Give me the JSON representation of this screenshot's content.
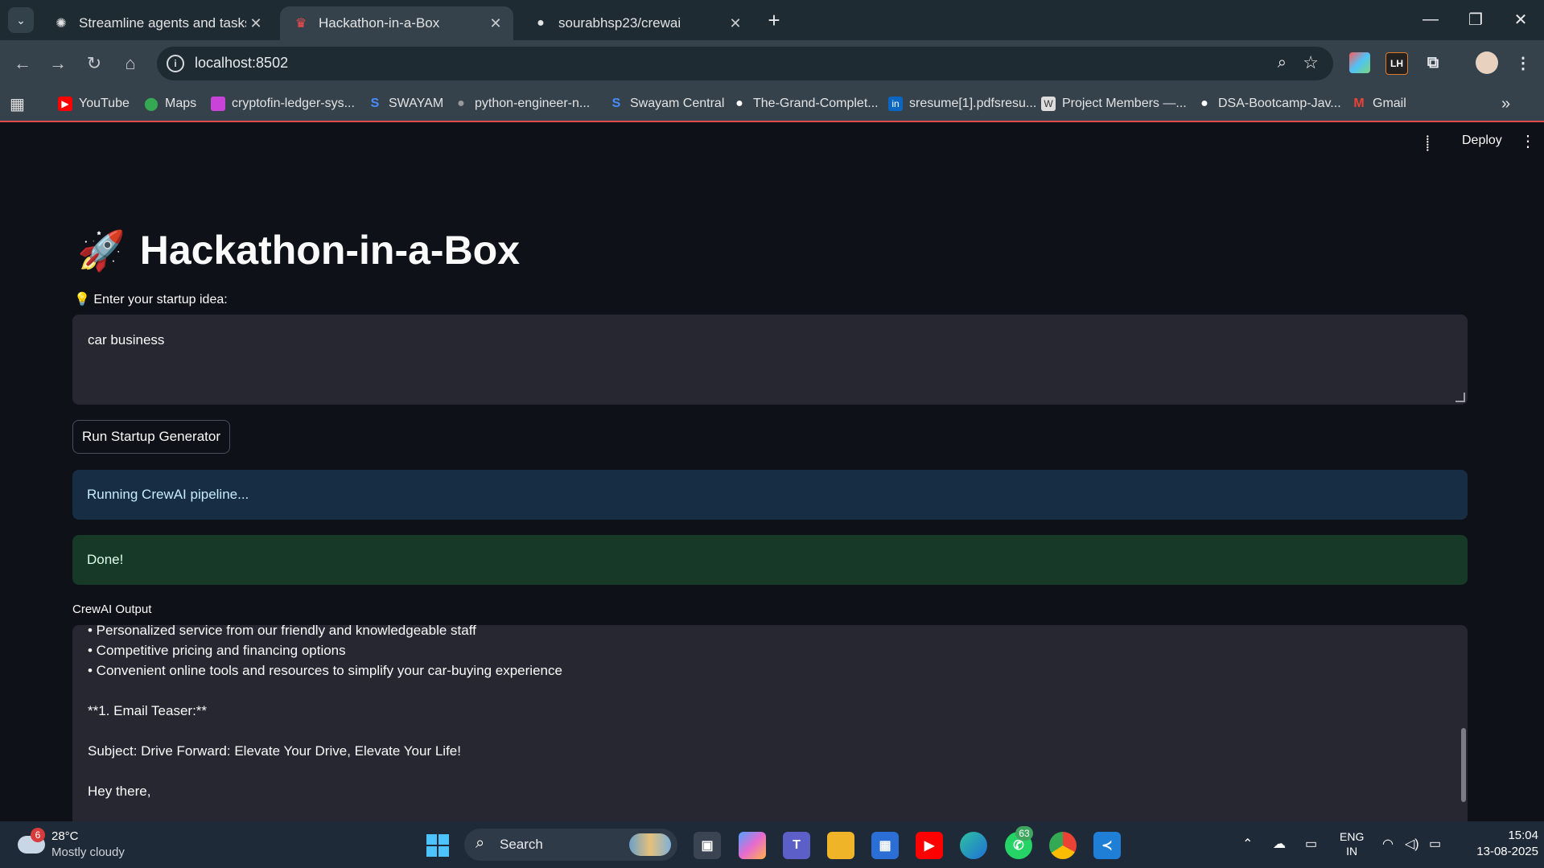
{
  "browser": {
    "tabs": [
      {
        "title": "Streamline agents and tasks",
        "active": false
      },
      {
        "title": "Hackathon-in-a-Box",
        "active": true
      },
      {
        "title": "sourabhsp23/crewai",
        "active": false
      }
    ],
    "url": "localhost:8502",
    "bookmarks": [
      {
        "label": "YouTube",
        "icon": "youtube-icon"
      },
      {
        "label": "Maps",
        "icon": "maps-icon"
      },
      {
        "label": "cryptofin-ledger-sys...",
        "icon": "bookmark-icon"
      },
      {
        "label": "SWAYAM",
        "icon": "swayam-icon"
      },
      {
        "label": "python-engineer-n...",
        "icon": "github-icon"
      },
      {
        "label": "Swayam Central",
        "icon": "swayam-icon"
      },
      {
        "label": "The-Grand-Complet...",
        "icon": "github-icon"
      },
      {
        "label": "sresume[1].pdfsresu...",
        "icon": "linkedin-icon"
      },
      {
        "label": "Project Members —...",
        "icon": "wordpress-icon"
      },
      {
        "label": "DSA-Bootcamp-Jav...",
        "icon": "github-icon"
      },
      {
        "label": "Gmail",
        "icon": "gmail-icon"
      }
    ],
    "extensions": [
      "LH"
    ]
  },
  "app": {
    "toolbar": {
      "deploy_label": "Deploy"
    },
    "title": "Hackathon-in-a-Box",
    "title_icon": "🚀",
    "input_label": "💡 Enter your startup idea:",
    "input_value": "car business",
    "run_button": "Run Startup Generator",
    "info_message": "Running CrewAI pipeline...",
    "success_message": "Done!",
    "output_label": "CrewAI Output",
    "output_lines": [
      "• Personalized service from our friendly and knowledgeable staff",
      "• Competitive pricing and financing options",
      "• Convenient online tools and resources to simplify your car-buying experience",
      "",
      "**1. Email Teaser:**",
      "",
      "Subject: Drive Forward: Elevate Your Drive, Elevate Your Life!",
      "",
      "Hey there,"
    ]
  },
  "taskbar": {
    "weather": {
      "temp": "28°C",
      "desc": "Mostly cloudy",
      "badge": "6"
    },
    "search_placeholder": "Search",
    "whatsapp_badge": "63",
    "tray": {
      "lang1": "ENG",
      "lang2": "IN"
    },
    "clock": {
      "time": "15:04",
      "date": "13-08-2025"
    }
  },
  "colors": {
    "app_bg": "#0e1117",
    "info_bg": "#172d43",
    "success_bg": "#173928",
    "input_bg": "#262730"
  }
}
